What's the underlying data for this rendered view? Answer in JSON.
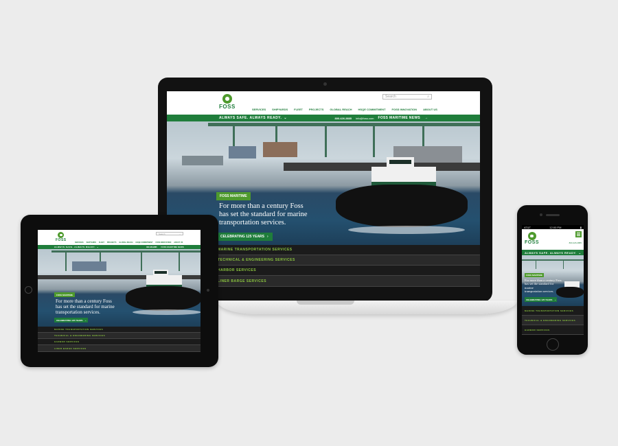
{
  "brand": {
    "name": "FOSS",
    "green": "#1f7d3b",
    "light_green": "#4e9a2d",
    "accent_text": "#8cc63f"
  },
  "search": {
    "placeholder": "Search",
    "icon": "search-icon"
  },
  "nav": [
    "SERVICES",
    "SHIPYARDS",
    "FLEET",
    "PROJECTS",
    "GLOBAL REACH",
    "HSQE COMMITMENT",
    "FOSS INNOVATION",
    "ABOUT US"
  ],
  "bar": {
    "tagline": "ALWAYS SAFE. ALWAYS READY.",
    "phone": "800.426.2885",
    "email": "info@foss.com",
    "news": "FOSS MARITIME NEWS"
  },
  "hero": {
    "pill": "FOSS MARITIME",
    "headline_1": "For more than a century Foss",
    "headline_2": "has set the standard for marine",
    "headline_3": "transportation services.",
    "cta": "CELEBRATING 125 YEARS"
  },
  "services": [
    "MARINE TRANSPORTATION SERVICES",
    "TECHNICAL & ENGINEERING SERVICES",
    "HARBOR SERVICES",
    "LINER BARGE SERVICES"
  ],
  "phone_status": {
    "carrier": "AT&T",
    "time": "12:00 PM"
  },
  "phone_number": "800.426.2885"
}
